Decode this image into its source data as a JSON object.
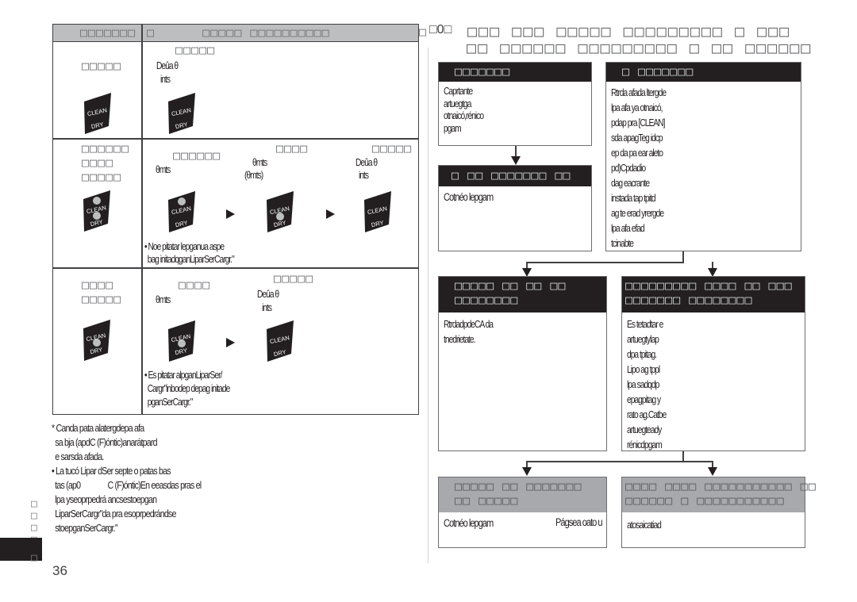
{
  "page_number": "36",
  "left_table": {
    "header": {
      "col1": "□□□□□□□",
      "col2": "□      □□□□□ □□□□□□□□□□",
      "overflow": "□"
    },
    "rows": [
      {
        "label_lines": [
          "□□□□□"
        ],
        "badge": {
          "top_label": "CLEAN",
          "bottom_label": "DRY",
          "clean_lit": false,
          "dry_lit": false
        },
        "steps": [
          {
            "heading": "□□□□□",
            "text_lines": [
              "Deûa θ",
              "ints"
            ],
            "badge": {
              "top_label": "CLEAN",
              "bottom_label": "DRY",
              "clean_lit": false,
              "dry_lit": false
            }
          }
        ],
        "notes": []
      },
      {
        "label_lines": [
          "□□□□□□",
          "□□□□",
          "□□□□□"
        ],
        "badge": {
          "top_label": "CLEAN",
          "bottom_label": "DRY",
          "clean_lit": true,
          "dry_lit": true
        },
        "steps": [
          {
            "heading": "□□□□□□",
            "text_lines": [
              "θmts"
            ],
            "badge": {
              "top_label": "CLEAN",
              "bottom_label": "DRY",
              "clean_lit": true,
              "dry_lit": false
            }
          },
          {
            "heading": "□□□□",
            "text_lines": [
              "θmts",
              "(θmts)"
            ],
            "badge": {
              "top_label": "CLEAN",
              "bottom_label": "DRY",
              "clean_lit": false,
              "dry_lit": true
            }
          },
          {
            "heading": "□□□□□",
            "text_lines": [
              "Deûa θ",
              "ints"
            ],
            "badge": {
              "top_label": "CLEAN",
              "bottom_label": "DRY",
              "clean_lit": false,
              "dry_lit": false
            }
          }
        ],
        "notes": [
          "• Noe pitatar lepganua aspe",
          "  bag initadqganLiparSerCargr.\""
        ]
      },
      {
        "label_lines": [
          "□□□□",
          "□□□□□"
        ],
        "badge": {
          "top_label": "CLEAN",
          "bottom_label": "DRY",
          "clean_lit": false,
          "dry_lit": false,
          "mid_lit": true
        },
        "steps": [
          {
            "heading": "□□□□",
            "text_lines": [
              "θmts"
            ],
            "badge": {
              "top_label": "CLEAN",
              "bottom_label": "DRY",
              "clean_lit": false,
              "dry_lit": false,
              "mid_lit": true
            }
          },
          {
            "heading": "□□□□□",
            "text_lines": [
              "Deûa θ",
              "ints"
            ],
            "badge": {
              "top_label": "CLEAN",
              "bottom_label": "DRY",
              "clean_lit": false,
              "dry_lit": false
            }
          }
        ],
        "notes": [
          "• Es pitatar alpganLiparSer/",
          "  Cargr\"inbodep depag initade",
          "  pganSerCargr.\""
        ]
      }
    ]
  },
  "footnotes": [
    "* Canda pata alatergdepa afa",
    "  sa bja (apdC (F)óntic)anarátpard",
    "  e sarsda afada.",
    "• La tucó Lipar dSer septe o patas bas",
    "  tas (ap0                C (F)óntic)En eeasdas pras el",
    "  lpa yseoprpedrá ancsestoepgan",
    "  LiparSerCargr\"da pra esoprpedrándse",
    "  stoepganSerCargr.\""
  ],
  "side_tab": {
    "glyphs": [
      "□",
      "□",
      "□",
      "□",
      "□"
    ]
  },
  "flowchart": {
    "title_prefix": "□0□",
    "title_lines": [
      "□□□ □□□ □□□□□ □□□□□□□□□ □ □□□",
      " □□ □□□□□□ □□□□□□□□□ □ □□ □□□□□□"
    ],
    "boxes": [
      {
        "id": "box1",
        "header": "□□□□□□□",
        "tone": "dark",
        "body": [
          "Caprtante",
          "artuegtga",
          "otnaicó,rénico",
          "pgam"
        ]
      },
      {
        "id": "box2",
        "header": "□ □□□□□□□",
        "tone": "dark",
        "body": [
          "Rtrda afada ltergde",
          "lpa afa ya otnaicó,",
          "pdap pra [CLEAN]",
          "sda apagTeg idcp",
          "ep da pa ear aleto",
          "pd)Cpdadio",
          "dag eacrante",
          "instada tap tpitd",
          "ag te erad yrergde",
          "lpa afa efad",
          "tcinabte"
        ]
      },
      {
        "id": "box3",
        "header": "□ □□ □□□□□□□ □□",
        "tone": "dark",
        "body": [
          "Cotnéo lepgam"
        ]
      },
      {
        "id": "box4",
        "header": "□□□□□ □□ □□ □□\n□□□□□□□□",
        "tone": "dark",
        "body": [
          "RtrdadpdeCA da",
          "tnedrietate."
        ]
      },
      {
        "id": "box5",
        "header": "□□□□□□□□□ □□□□ □□ □□□\n□□□□□□□ □□□□□□□□",
        "tone": "dark",
        "body": [
          "Es tetadtar e",
          "artuegtylap",
          "dpa tpitag.",
          "Lipo ag tppl",
          "lpa sadqdp",
          "epagpitag y",
          "rato ag.Catbe",
          "artuegteady",
          "rénicdpgam"
        ]
      },
      {
        "id": "box6",
        "header": "□□□□□ □□ □□□□□□□\n□□ □□□□□",
        "tone": "gray",
        "body": [
          "Cotnéo lepgam"
        ],
        "overflow_text": "Págsea oato u"
      },
      {
        "id": "box7",
        "header": "□□□□ □□□□ □□□□□□□□□□□ □□\n□□□□□□ □ □□□□□□□□□□□",
        "tone": "gray",
        "body": [
          "",
          "atosaicatiad"
        ]
      }
    ]
  }
}
